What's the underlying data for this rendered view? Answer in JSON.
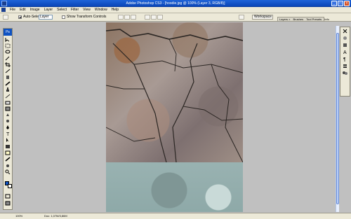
{
  "window": {
    "title": "Adobe Photoshop CS3 - [hoodie.jpg @ 100% (Layer 3, RGB/8)]"
  },
  "menubar": {
    "items": [
      "File",
      "Edit",
      "Image",
      "Layer",
      "Select",
      "Filter",
      "View",
      "Window",
      "Help"
    ]
  },
  "options": {
    "auto_select_label": "Auto-Select:",
    "auto_select_value": "Layer",
    "show_transform_label": "Show Transform Controls",
    "workspace_label": "Workspace"
  },
  "palette_well": {
    "tabs": [
      "Layers ×",
      "Brushes",
      "Tool Presets",
      "Info"
    ]
  },
  "status": {
    "zoom": "100%",
    "doc": "Doc: 1,07M/3,86M"
  },
  "colors": {
    "titlebar": "#0a46b8",
    "chrome": "#ece9d8",
    "workspace_bg": "#c0c0c0",
    "foreground": "#0f52c2",
    "background": "#ffffff"
  }
}
